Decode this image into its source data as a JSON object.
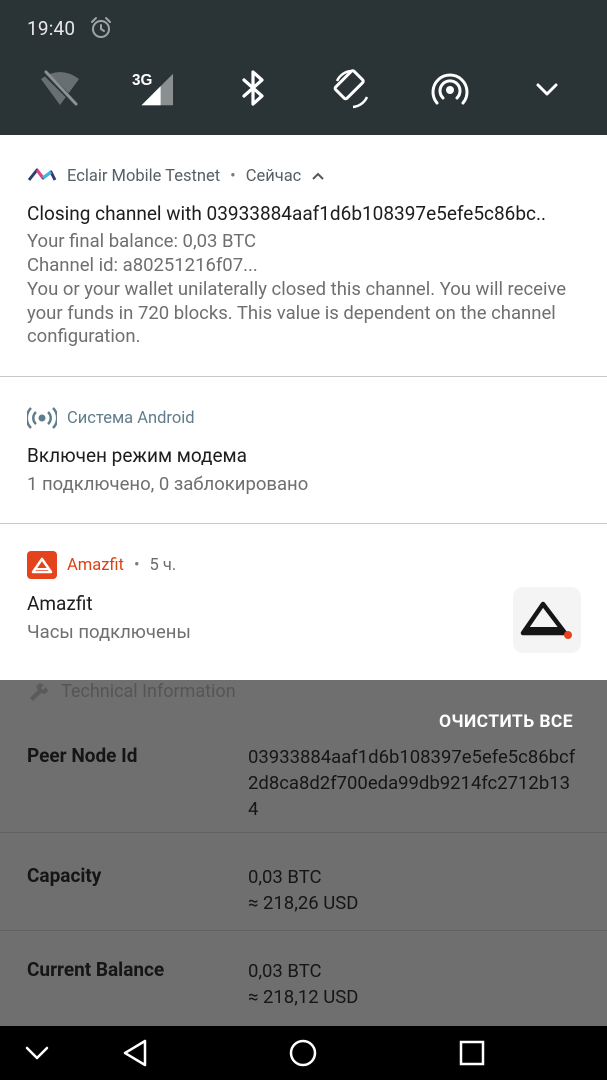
{
  "status_bar": {
    "time": "19:40"
  },
  "background": {
    "section_title": "Technical Information",
    "rows": [
      {
        "label": "Peer Node Id",
        "value": "03933884aaf1d6b108397e5efe5c86bcf2d8ca8d2f700eda99db9214fc2712b134"
      },
      {
        "label": "Capacity",
        "value1": "0,03 BTC",
        "value2": "≈ 218,26 USD"
      },
      {
        "label": "Current Balance",
        "value1": "0,03 BTC",
        "value2": "≈ 218,12 USD"
      }
    ]
  },
  "clear_all_label": "ОЧИСТИТЬ ВСЕ",
  "notifications": [
    {
      "app": "Eclair Mobile Testnet",
      "time": "Сейчас",
      "title": "Closing channel with 03933884aaf1d6b108397e5efe5c86bc..",
      "lines": [
        "Your final balance: 0,03 BTC",
        "Channel id: a80251216f07...",
        "You or your wallet unilaterally closed this channel. You will receive your funds in 720 blocks. This value is dependent on the channel configuration."
      ],
      "app_color": "#555f66"
    },
    {
      "app": "Система Android",
      "title": "Включен режим модема",
      "text": "1 подключено, 0 заблокировано",
      "app_color": "#607d8b"
    },
    {
      "app": "Amazfit",
      "time": "5 ч.",
      "title": "Amazfit",
      "text": "Часы подключены",
      "app_color": "#d84315"
    }
  ]
}
